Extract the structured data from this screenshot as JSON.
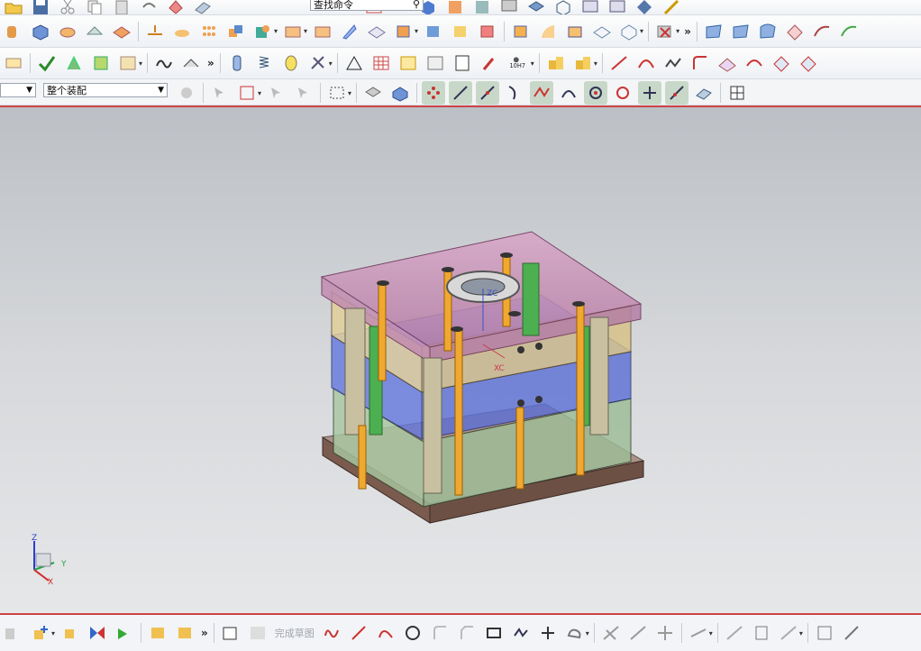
{
  "top_toolbar": {
    "search_placeholder": "查找命令"
  },
  "assembly_toolbar": {
    "filter_value": "",
    "scope_value": "整个装配"
  },
  "bottom_toolbar": {
    "finish_sketch_label": "完成草图"
  },
  "viewport": {
    "triad_labels": {
      "z": "Z",
      "y": "Y",
      "x": "X"
    },
    "csys_labels": {
      "zc": "ZC",
      "xc": "XC"
    }
  },
  "colors": {
    "accent_red": "#cc3333",
    "top_plate": "#c88fb0",
    "cavity_plate": "#d9c58a",
    "core_plate": "#6f7fe0",
    "support_plate": "#9fc39a",
    "bottom_plate": "#8b6a5c"
  },
  "icons": [
    "open-file-icon",
    "save-icon",
    "cut-icon",
    "copy-icon",
    "paste-icon",
    "undo-icon",
    "redo-icon",
    "wcs-icon",
    "extrude-icon",
    "revolve-icon",
    "hole-icon",
    "boss-icon",
    "pattern-icon",
    "unite-icon",
    "subtract-icon",
    "blend-icon",
    "chamfer-icon",
    "draft-icon",
    "shell-icon",
    "offset-icon",
    "trim-icon",
    "split-icon",
    "mirror-icon",
    "measure-icon",
    "line-icon",
    "arc-icon",
    "circle-icon",
    "rectangle-icon",
    "spline-icon",
    "point-icon",
    "dimension-icon",
    "constraint-icon"
  ]
}
